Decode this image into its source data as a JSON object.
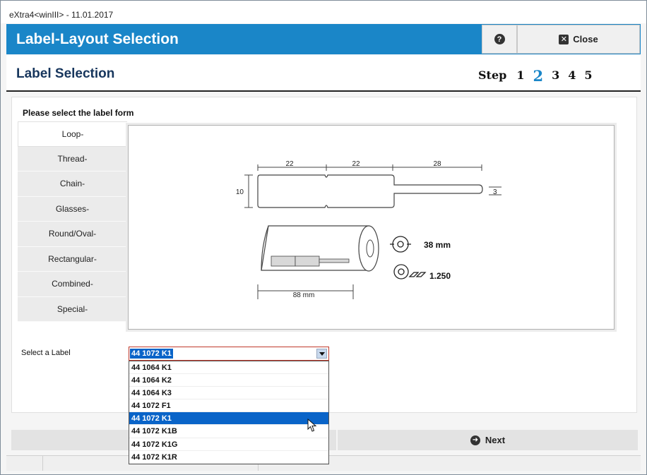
{
  "window": {
    "title": "eXtra4<winIII>  -  11.01.2017"
  },
  "header": {
    "title": "Label-Layout Selection",
    "help_icon": "question-circle-icon",
    "close_label": "Close"
  },
  "subheader": {
    "title": "Label Selection",
    "step_label": "Step",
    "steps": [
      "1",
      "2",
      "3",
      "4",
      "5"
    ],
    "active_step": "2"
  },
  "form": {
    "heading": "Please select the label form",
    "tabs": [
      "Loop-",
      "Thread-",
      "Chain-",
      "Glasses-",
      "Round/Oval-",
      "Rectangular-",
      "Combined-",
      "Special-"
    ],
    "active_tab": "Loop-"
  },
  "preview": {
    "dimensions": [
      "22",
      "22",
      "28"
    ],
    "height": "10",
    "tail_height": "3",
    "roll_width": "88 mm",
    "core_diameter": "38 mm",
    "quantity": "1.250"
  },
  "select": {
    "label": "Select a Label",
    "value": "44 1072 K1",
    "options": [
      "44 1064 K1",
      "44 1064 K2",
      "44 1064 K3",
      "44 1072 F1",
      "44 1072 K1",
      "44 1072 K1B",
      "44 1072 K1G",
      "44 1072 K1R"
    ],
    "selected_index": 4
  },
  "footer": {
    "next_label": "Next"
  }
}
